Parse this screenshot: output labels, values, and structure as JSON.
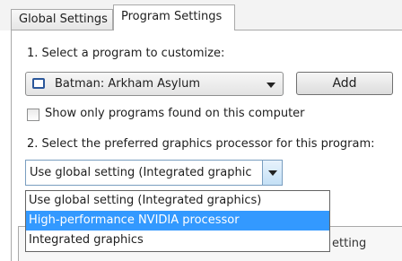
{
  "tabs": [
    {
      "label": "Global Settings"
    },
    {
      "label": "Program Settings"
    }
  ],
  "section1": {
    "label": "1. Select a program to customize:",
    "program_value": "Batman: Arkham Asylum",
    "program_icon": "window-icon",
    "add_label": "Add",
    "checkbox_label": "Show only programs found on this computer",
    "checkbox_checked": false
  },
  "section2": {
    "label": "2. Select the preferred graphics processor for this program:",
    "selected_value": "Use global setting (Integrated graphic",
    "options": [
      "Use global setting (Integrated graphics)",
      "High-performance NVIDIA processor",
      "Integrated graphics"
    ],
    "highlighted_index": 1,
    "highlight_color": "#3399ff"
  },
  "background": {
    "partial_header": "etting"
  }
}
